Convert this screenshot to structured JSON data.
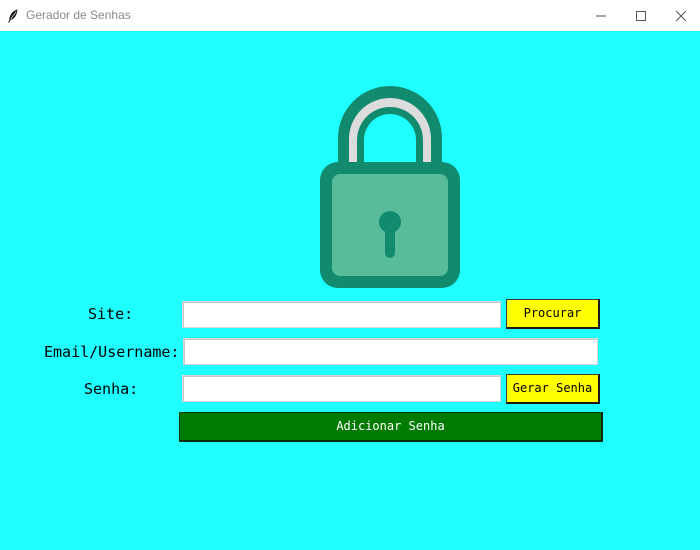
{
  "window": {
    "title": "Gerador de Senhas",
    "background_color": "#1fffff",
    "controls": [
      "minimize-icon",
      "maximize-icon",
      "close-icon"
    ]
  },
  "logo": {
    "icon": "padlock-icon",
    "colors": {
      "body": "#58bc9a",
      "outline": "#128a6e",
      "shackle": "#dcdcdc"
    }
  },
  "form": {
    "site_label": "Site:",
    "site_value": "",
    "search_button": "Procurar",
    "email_label": "Email/Username:",
    "email_value": "",
    "password_label": "Senha:",
    "password_value": "",
    "generate_button": "Gerar Senha",
    "add_button": "Adicionar Senha",
    "colors": {
      "yellow_button": "#ffff00",
      "green_button": "#007a00"
    }
  }
}
